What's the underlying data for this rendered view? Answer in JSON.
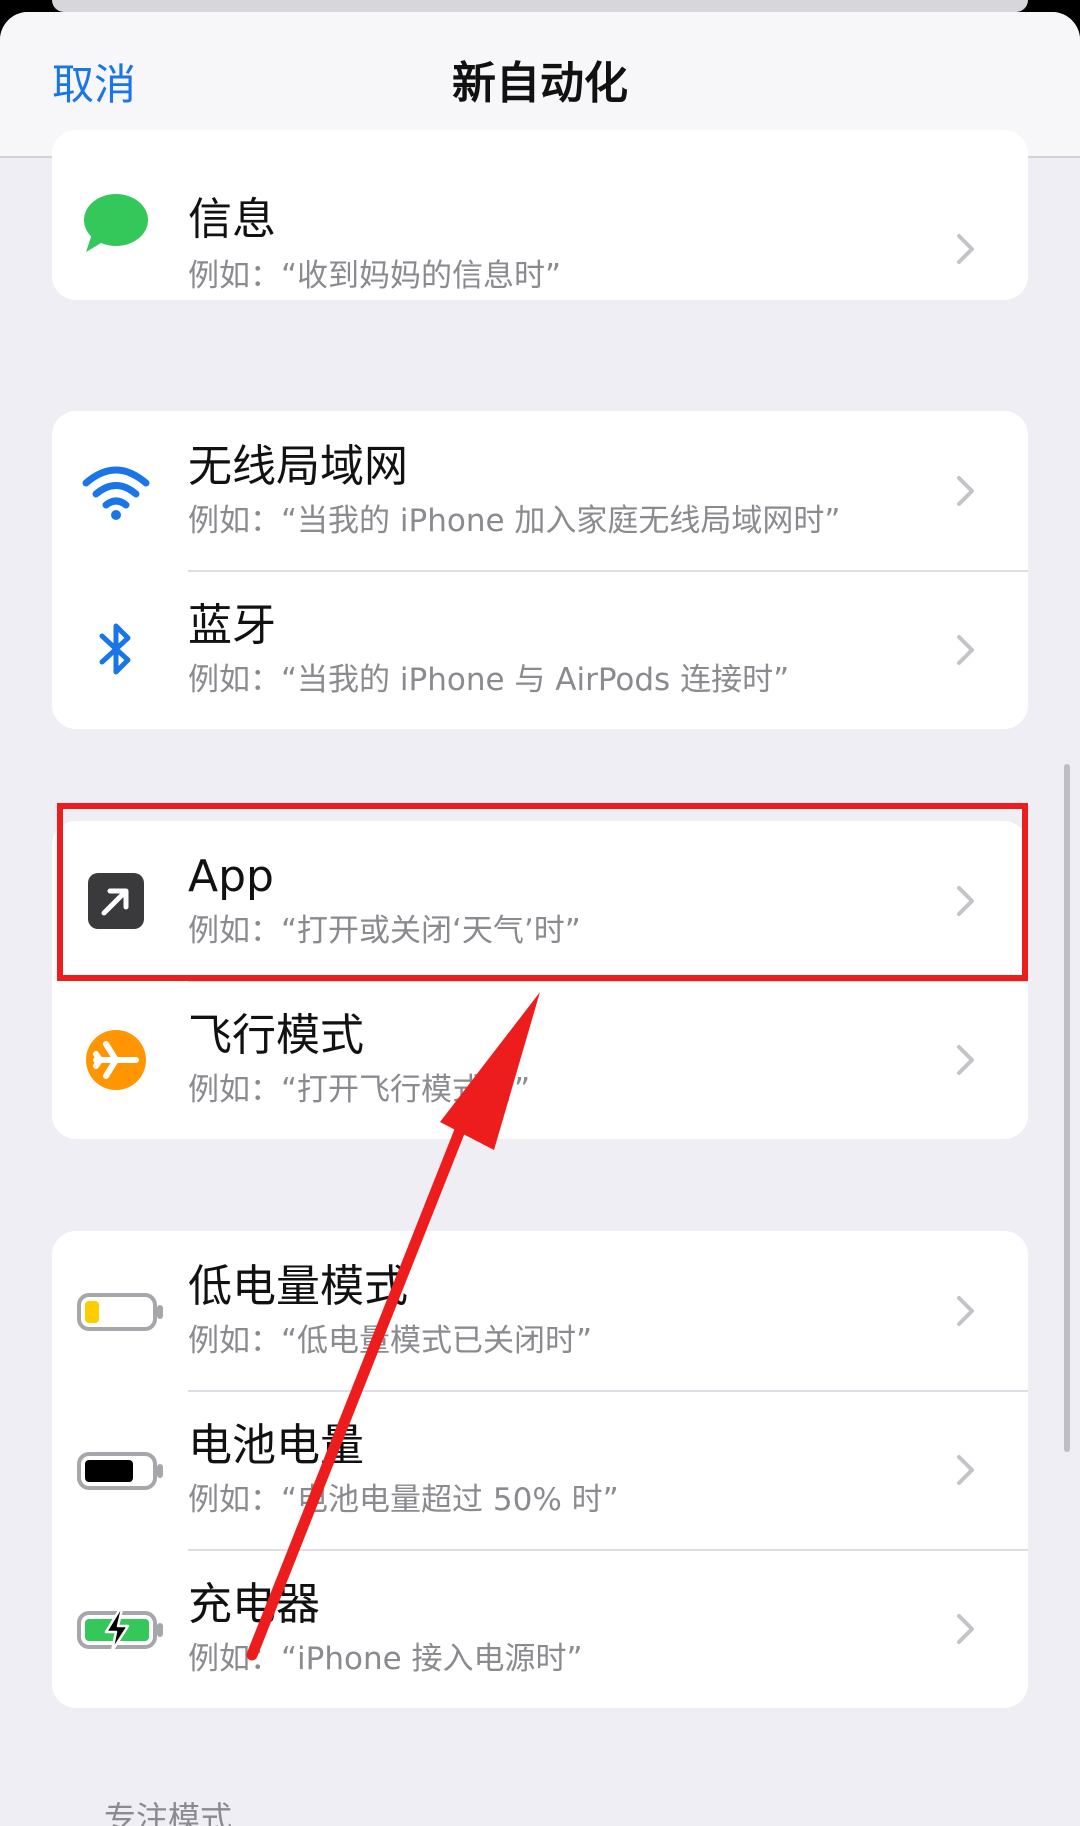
{
  "nav": {
    "cancel_label": "取消",
    "title": "新自动化"
  },
  "groups": [
    {
      "rows": [
        {
          "title": "信息",
          "subtitle": "例如：“收到妈妈的信息时”",
          "icon": "message-icon"
        }
      ]
    },
    {
      "rows": [
        {
          "title": "无线局域网",
          "subtitle": "例如：“当我的 iPhone 加入家庭无线局域网时”",
          "icon": "wifi-icon"
        },
        {
          "title": "蓝牙",
          "subtitle": "例如：“当我的 iPhone 与 AirPods 连接时”",
          "icon": "bluetooth-icon"
        }
      ]
    },
    {
      "rows": [
        {
          "title": "App",
          "subtitle": "例如：“打开或关闭‘天气’时”",
          "icon": "app-open-icon"
        },
        {
          "title": "飞行模式",
          "subtitle": "例如：“打开飞行模式时”",
          "icon": "airplane-icon"
        }
      ]
    },
    {
      "rows": [
        {
          "title": "低电量模式",
          "subtitle": "例如：“低电量模式已关闭时”",
          "icon": "low-battery-icon"
        },
        {
          "title": "电池电量",
          "subtitle": "例如：“电池电量超过 50% 时”",
          "icon": "battery-icon"
        },
        {
          "title": "充电器",
          "subtitle": "例如：“iPhone 接入电源时”",
          "icon": "charging-battery-icon"
        }
      ]
    }
  ],
  "section_label": "专注模式",
  "colors": {
    "accent": "#1a76e8",
    "highlight": "#ee1d1d",
    "message_green": "#34c759",
    "airplane_orange": "#ff9500"
  }
}
